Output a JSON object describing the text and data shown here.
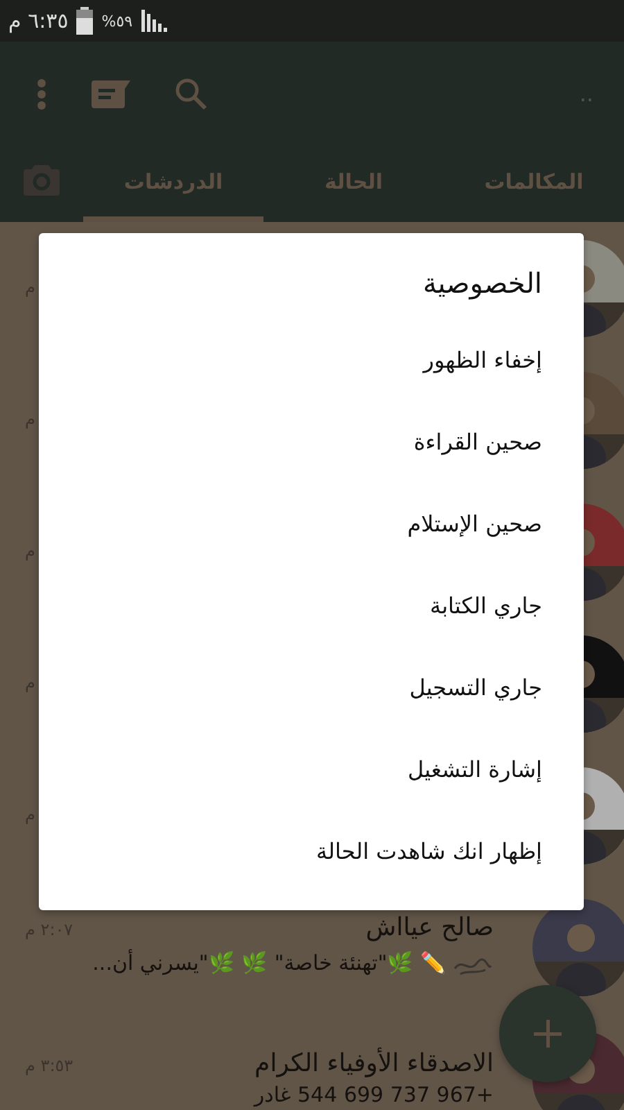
{
  "status_bar": {
    "time": "٦:٣٥ م",
    "battery": "%٥٩"
  },
  "toolbar": {
    "title": ".."
  },
  "tabs": [
    {
      "label": "المكالمات",
      "selected": false
    },
    {
      "label": "الحالة",
      "selected": false
    },
    {
      "label": "الدردشات",
      "selected": true
    }
  ],
  "chats": [
    {
      "kind": "covered",
      "time": "م"
    },
    {
      "kind": "covered",
      "time": "م"
    },
    {
      "kind": "covered",
      "time": "م"
    },
    {
      "kind": "covered",
      "time": "م"
    },
    {
      "kind": "covered",
      "time": "م"
    },
    {
      "kind": "sticker",
      "name": "صالح عيااش",
      "time": "٢:٠٧ م",
      "message": "✏️ 🌿\"تهنئة خاصة\" 🌿 🌿\"يسرني أن..."
    },
    {
      "kind": "text",
      "name": "الاصدقاء الأوفياء الكرام",
      "time": "٣:٥٣ م",
      "message": "+967 737 699 544 غادر"
    }
  ],
  "dialog": {
    "title": "الخصوصية",
    "options": [
      "إخفاء الظهور",
      "صحين القراءة",
      "صحين الإستلام",
      "جاري الكتابة",
      "جاري التسجيل",
      "إشارة التشغيل",
      "إظهار انك شاهدت الحالة"
    ]
  }
}
